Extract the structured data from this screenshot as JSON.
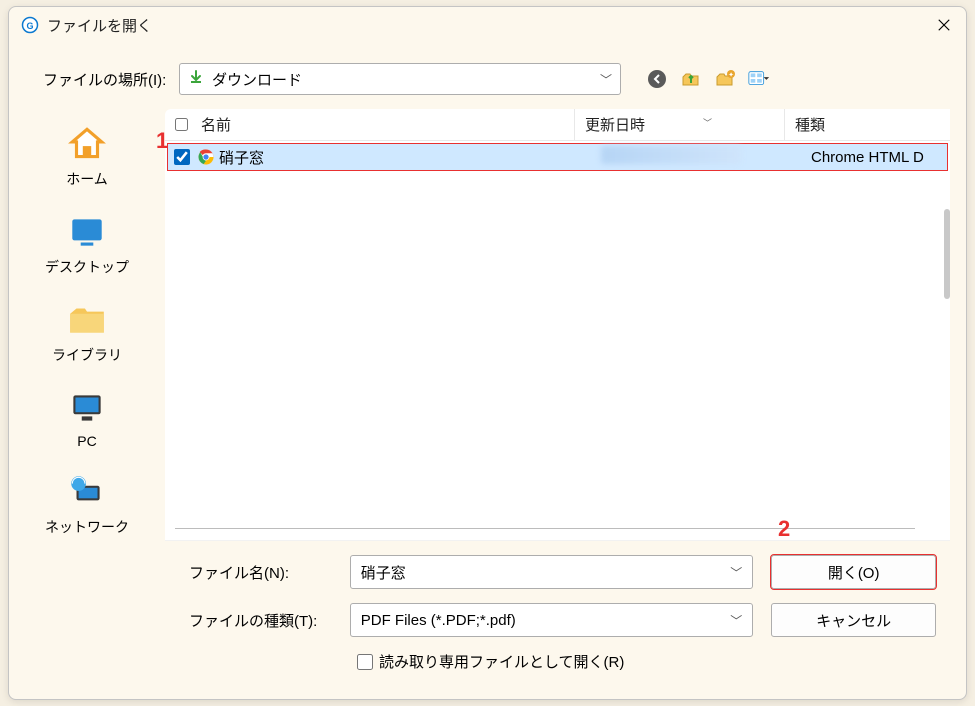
{
  "window": {
    "title": "ファイルを開く"
  },
  "location": {
    "label": "ファイルの場所(I):",
    "value": "ダウンロード"
  },
  "columns": {
    "name": "名前",
    "date": "更新日時",
    "type": "種類"
  },
  "file": {
    "name": "硝子窓",
    "type": "Chrome HTML D"
  },
  "sidebar": {
    "home": "ホーム",
    "desktop": "デスクトップ",
    "library": "ライブラリ",
    "pc": "PC",
    "network": "ネットワーク"
  },
  "bottom": {
    "filename_label": "ファイル名(N):",
    "filename_value": "硝子窓",
    "filetype_label": "ファイルの種類(T):",
    "filetype_value": "PDF Files (*.PDF;*.pdf)",
    "open_btn": "開く(O)",
    "cancel_btn": "キャンセル",
    "readonly_label": "読み取り専用ファイルとして開く(R)"
  },
  "annotations": {
    "one": "1",
    "two": "2"
  }
}
